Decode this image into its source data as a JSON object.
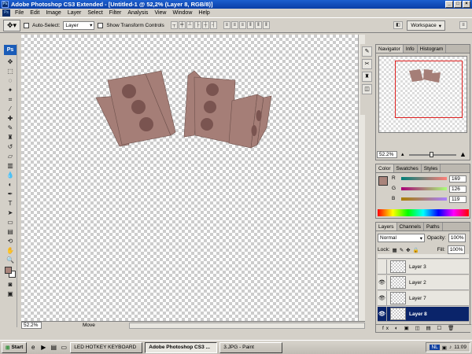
{
  "window": {
    "title": "Adobe Photoshop CS3 Extended - [Untitled-1 @ 52,2% (Layer 8, RGB/8)]"
  },
  "menu": [
    "File",
    "Edit",
    "Image",
    "Layer",
    "Select",
    "Filter",
    "Analysis",
    "View",
    "Window",
    "Help"
  ],
  "options": {
    "auto_select_label": "Auto-Select:",
    "auto_select_value": "Layer",
    "transform_label": "Show Transform Controls",
    "workspace_label": "Workspace"
  },
  "toolbox": {
    "badge": "Ps"
  },
  "status": {
    "zoom": "52.2%",
    "info": "Move"
  },
  "navigator": {
    "tabs": [
      "Navigator",
      "Info",
      "Histogram"
    ],
    "zoom": "52.2%"
  },
  "color_panel": {
    "tabs": [
      "Color",
      "Swatches",
      "Styles"
    ],
    "r_label": "R",
    "g_label": "G",
    "b_label": "B",
    "r": "169",
    "g": "126",
    "b": "119",
    "swatch": "#a9847b"
  },
  "layers_panel": {
    "tabs": [
      "Layers",
      "Channels",
      "Paths"
    ],
    "blend_mode": "Normal",
    "opacity_label": "Opacity:",
    "opacity": "100%",
    "lock_label": "Lock:",
    "fill_label": "Fill:",
    "fill": "100%",
    "layers": [
      {
        "name": "Layer 3",
        "visible": false,
        "selected": false
      },
      {
        "name": "Layer 2",
        "visible": true,
        "selected": false
      },
      {
        "name": "Layer 7",
        "visible": true,
        "selected": false
      },
      {
        "name": "Layer 8",
        "visible": true,
        "selected": true
      }
    ],
    "bottom_icons": "fx ◐ ▣ ◫ ▤ ☐ 🗑"
  },
  "taskbar": {
    "start": "Start",
    "items": [
      "LED HOTKEY KEYBOARD",
      "Adobe Photoshop CS3 ...",
      "3.JPG - Paint"
    ],
    "active_index": 1,
    "clock": "11:09",
    "lang": "NL"
  },
  "colors": {
    "piece": "#a57e77",
    "dot": "#7a5450",
    "selection": "#0a246a"
  }
}
